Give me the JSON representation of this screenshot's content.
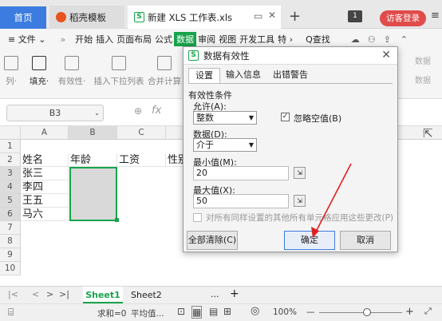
{
  "tabs": {
    "home": "首页",
    "templates": "稻壳模板",
    "document": "新建 XLS 工作表.xls",
    "new_tab": "+",
    "badge": "1",
    "visitor": "访客登录"
  },
  "menu": {
    "items": [
      "≡ 文件 ⌄",
      "»",
      "开始",
      "插入",
      "页面布局",
      "公式",
      "数据",
      "审阅",
      "视图",
      "开发工具",
      "特 ›"
    ],
    "search": "Q查找"
  },
  "toolbar": {
    "items": [
      "列·",
      "填充·",
      "有效性·",
      "插入下拉列表",
      "合并计算",
      "...",
      "数据"
    ]
  },
  "formula": {
    "cell_ref": "B3",
    "fx": "fx"
  },
  "grid": {
    "columns": [
      "A",
      "B",
      "C"
    ],
    "rows": [
      "1",
      "2",
      "3",
      "4",
      "5",
      "6",
      "7",
      "8",
      "9",
      "10"
    ],
    "header_row": [
      "姓名",
      "年龄",
      "工资",
      "性别"
    ],
    "names": [
      "张三",
      "李四",
      "王五",
      "马六"
    ]
  },
  "sheets": {
    "active": "Sheet1",
    "other": "Sheet2",
    "more": "...",
    "add": "+"
  },
  "status": {
    "sum": "求和=0",
    "avg": "平均值...",
    "zoom": "100%",
    "minus": "—",
    "plus": "+"
  },
  "dialog": {
    "title": "数据有效性",
    "tabs": [
      "设置",
      "输入信息",
      "出错警告"
    ],
    "section": "有效性条件",
    "allow_label": "允许(A):",
    "allow_value": "整数",
    "ignore_blank": "忽略空值(B)",
    "data_label": "数据(D):",
    "data_value": "介于",
    "min_label": "最小值(M):",
    "min_value": "20",
    "max_label": "最大值(X):",
    "max_value": "50",
    "apply_all": "对所有同样设置的其他所有单元格应用这些更改(P)",
    "clear_all": "全部清除(C)",
    "ok": "确定",
    "cancel": "取消"
  },
  "colors": {
    "accent": "#3c7ce0",
    "annotation": "#e02020",
    "selection": "#17a44b"
  }
}
